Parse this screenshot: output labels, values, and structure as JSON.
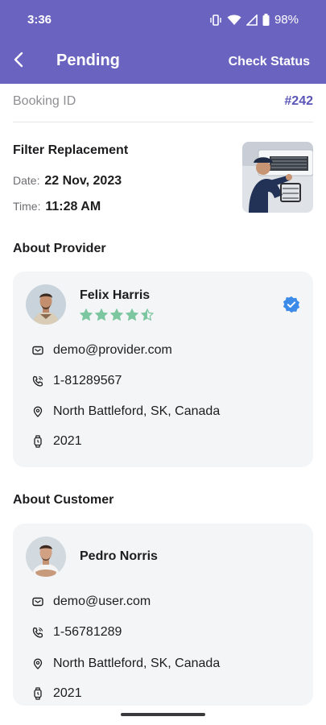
{
  "status_bar": {
    "time": "3:36",
    "battery": "98%"
  },
  "app_bar": {
    "title": "Pending",
    "action": "Check Status"
  },
  "booking": {
    "label": "Booking ID",
    "value": "#242"
  },
  "service": {
    "name": "Filter Replacement",
    "date_label": "Date:",
    "date_value": "22 Nov, 2023",
    "time_label": "Time:",
    "time_value": "11:28 AM"
  },
  "provider": {
    "section_title": "About Provider",
    "name": "Felix Harris",
    "rating": 4.5,
    "email": "demo@provider.com",
    "phone": "1-81289567",
    "address": "North Battleford, SK, Canada",
    "since": "2021"
  },
  "customer": {
    "section_title": "About Customer",
    "name": "Pedro Norris",
    "email": "demo@user.com",
    "phone": "1-56781289",
    "address": "North Battleford, SK, Canada",
    "since": "2021"
  },
  "colors": {
    "primary": "#6a63bf",
    "star": "#7cc6a0",
    "verified": "#3d8be8",
    "card_bg": "#f4f5f7"
  }
}
